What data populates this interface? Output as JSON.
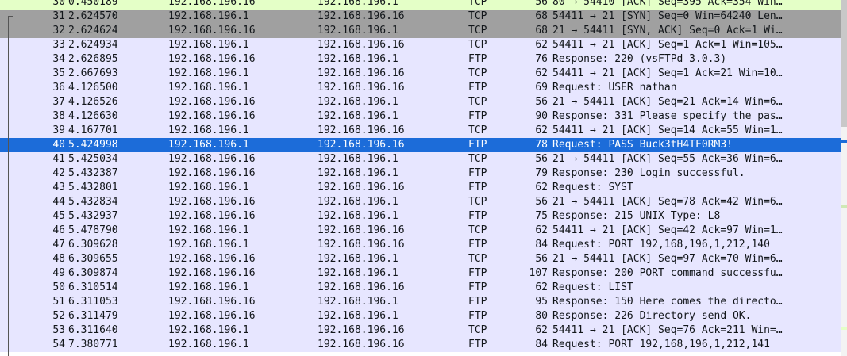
{
  "packets": [
    {
      "no": "30",
      "time": "0.450189",
      "src": "192.168.196.16",
      "dst": "192.168.196.1",
      "proto": "TCP",
      "len": "56",
      "info": "80 → 54410 [ACK] Seq=395 Ack=354 Win…"
    },
    {
      "no": "31",
      "time": "2.624570",
      "src": "192.168.196.1",
      "dst": "192.168.196.16",
      "proto": "TCP",
      "len": "68",
      "info": "54411 → 21 [SYN] Seq=0 Win=64240 Len…"
    },
    {
      "no": "32",
      "time": "2.624624",
      "src": "192.168.196.16",
      "dst": "192.168.196.1",
      "proto": "TCP",
      "len": "68",
      "info": "21 → 54411 [SYN, ACK] Seq=0 Ack=1 Wi…"
    },
    {
      "no": "33",
      "time": "2.624934",
      "src": "192.168.196.1",
      "dst": "192.168.196.16",
      "proto": "TCP",
      "len": "62",
      "info": "54411 → 21 [ACK] Seq=1 Ack=1 Win=105…"
    },
    {
      "no": "34",
      "time": "2.626895",
      "src": "192.168.196.16",
      "dst": "192.168.196.1",
      "proto": "FTP",
      "len": "76",
      "info": "Response: 220 (vsFTPd 3.0.3)"
    },
    {
      "no": "35",
      "time": "2.667693",
      "src": "192.168.196.1",
      "dst": "192.168.196.16",
      "proto": "TCP",
      "len": "62",
      "info": "54411 → 21 [ACK] Seq=1 Ack=21 Win=10…"
    },
    {
      "no": "36",
      "time": "4.126500",
      "src": "192.168.196.1",
      "dst": "192.168.196.16",
      "proto": "FTP",
      "len": "69",
      "info": "Request: USER nathan"
    },
    {
      "no": "37",
      "time": "4.126526",
      "src": "192.168.196.16",
      "dst": "192.168.196.1",
      "proto": "TCP",
      "len": "56",
      "info": "21 → 54411 [ACK] Seq=21 Ack=14 Win=6…"
    },
    {
      "no": "38",
      "time": "4.126630",
      "src": "192.168.196.16",
      "dst": "192.168.196.1",
      "proto": "FTP",
      "len": "90",
      "info": "Response: 331 Please specify the pas…"
    },
    {
      "no": "39",
      "time": "4.167701",
      "src": "192.168.196.1",
      "dst": "192.168.196.16",
      "proto": "TCP",
      "len": "62",
      "info": "54411 → 21 [ACK] Seq=14 Ack=55 Win=1…"
    },
    {
      "no": "40",
      "time": "5.424998",
      "src": "192.168.196.1",
      "dst": "192.168.196.16",
      "proto": "FTP",
      "len": "78",
      "info": "Request: PASS Buck3tH4TF0RM3!"
    },
    {
      "no": "41",
      "time": "5.425034",
      "src": "192.168.196.16",
      "dst": "192.168.196.1",
      "proto": "TCP",
      "len": "56",
      "info": "21 → 54411 [ACK] Seq=55 Ack=36 Win=6…"
    },
    {
      "no": "42",
      "time": "5.432387",
      "src": "192.168.196.16",
      "dst": "192.168.196.1",
      "proto": "FTP",
      "len": "79",
      "info": "Response: 230 Login successful."
    },
    {
      "no": "43",
      "time": "5.432801",
      "src": "192.168.196.1",
      "dst": "192.168.196.16",
      "proto": "FTP",
      "len": "62",
      "info": "Request: SYST"
    },
    {
      "no": "44",
      "time": "5.432834",
      "src": "192.168.196.16",
      "dst": "192.168.196.1",
      "proto": "TCP",
      "len": "56",
      "info": "21 → 54411 [ACK] Seq=78 Ack=42 Win=6…"
    },
    {
      "no": "45",
      "time": "5.432937",
      "src": "192.168.196.16",
      "dst": "192.168.196.1",
      "proto": "FTP",
      "len": "75",
      "info": "Response: 215 UNIX Type: L8"
    },
    {
      "no": "46",
      "time": "5.478790",
      "src": "192.168.196.1",
      "dst": "192.168.196.16",
      "proto": "TCP",
      "len": "62",
      "info": "54411 → 21 [ACK] Seq=42 Ack=97 Win=1…"
    },
    {
      "no": "47",
      "time": "6.309628",
      "src": "192.168.196.1",
      "dst": "192.168.196.16",
      "proto": "FTP",
      "len": "84",
      "info": "Request: PORT 192,168,196,1,212,140"
    },
    {
      "no": "48",
      "time": "6.309655",
      "src": "192.168.196.16",
      "dst": "192.168.196.1",
      "proto": "TCP",
      "len": "56",
      "info": "21 → 54411 [ACK] Seq=97 Ack=70 Win=6…"
    },
    {
      "no": "49",
      "time": "6.309874",
      "src": "192.168.196.16",
      "dst": "192.168.196.1",
      "proto": "FTP",
      "len": "107",
      "info": "Response: 200 PORT command successfu…"
    },
    {
      "no": "50",
      "time": "6.310514",
      "src": "192.168.196.1",
      "dst": "192.168.196.16",
      "proto": "FTP",
      "len": "62",
      "info": "Request: LIST"
    },
    {
      "no": "51",
      "time": "6.311053",
      "src": "192.168.196.16",
      "dst": "192.168.196.1",
      "proto": "FTP",
      "len": "95",
      "info": "Response: 150 Here comes the directo…"
    },
    {
      "no": "52",
      "time": "6.311479",
      "src": "192.168.196.16",
      "dst": "192.168.196.1",
      "proto": "FTP",
      "len": "80",
      "info": "Response: 226 Directory send OK."
    },
    {
      "no": "53",
      "time": "6.311640",
      "src": "192.168.196.1",
      "dst": "192.168.196.16",
      "proto": "TCP",
      "len": "62",
      "info": "54411 → 21 [ACK] Seq=76 Ack=211 Win=…"
    },
    {
      "no": "54",
      "time": "7.380771",
      "src": "192.168.196.1",
      "dst": "192.168.196.16",
      "proto": "FTP",
      "len": "84",
      "info": "Request: PORT 192,168,196,1,212,141"
    }
  ],
  "selected_packet": "40",
  "colors": {
    "tcp_ftp_row": "#e7e6ff",
    "http_row": "#e4ffc7",
    "tcp_syn_row": "#a0a0a0",
    "selected_row": "#1c6cd9"
  }
}
